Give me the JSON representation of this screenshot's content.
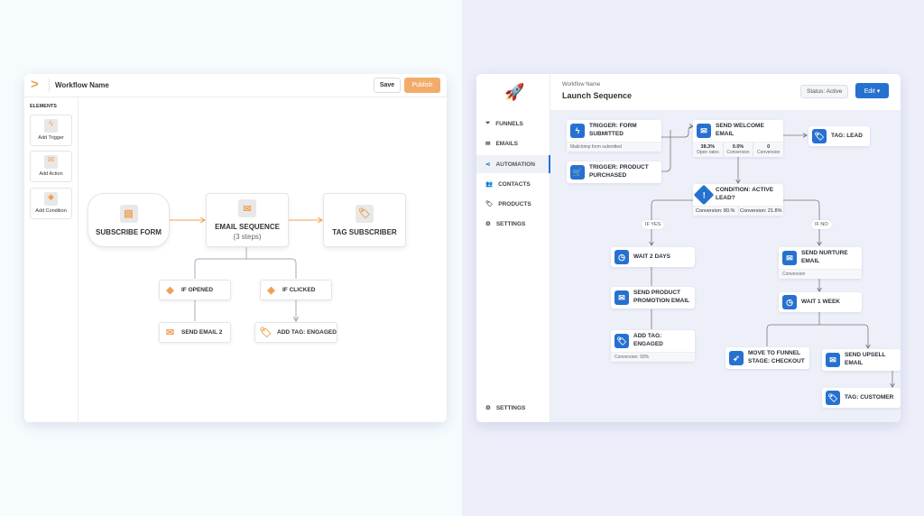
{
  "left": {
    "title": "Workflow Name",
    "save": "Save",
    "publish": "Publish",
    "elements_title": "ELEMENTS",
    "elements": [
      {
        "label": "Add Trigger",
        "icon": "bolt-icon"
      },
      {
        "label": "Add Action",
        "icon": "envelope-icon"
      },
      {
        "label": "Add Condition",
        "icon": "diamond-icon"
      }
    ],
    "nodes": {
      "subscribe": "SUBSCRIBE FORM",
      "email_seq": "EMAIL SEQUENCE",
      "email_steps": "(3 steps)",
      "tag_sub": "TAG SUBSCRIBER",
      "if_opened": "IF OPENED",
      "if_clicked": "IF CLICKED",
      "send_email2": "SEND EMAIL 2",
      "add_tag": "ADD TAG: ENGAGED"
    },
    "accent": "#f0a057"
  },
  "right": {
    "workflow_label": "Workflow Name",
    "title": "Launch Sequence",
    "status": "Status: Active",
    "edit": "Edit",
    "nav": [
      {
        "label": "FUNNELS",
        "icon": "funnel-icon"
      },
      {
        "label": "EMAILS",
        "icon": "envelope-icon"
      },
      {
        "label": "AUTOMATION",
        "icon": "share-icon",
        "active": true
      },
      {
        "label": "CONTACTS",
        "icon": "users-icon"
      },
      {
        "label": "PRODUCTS",
        "icon": "tag-icon"
      },
      {
        "label": "SETTINGS",
        "icon": "gear-icon"
      }
    ],
    "bottom_settings": "SETTINGS",
    "nodes": {
      "trigger_form": "TRIGGER: FORM SUBMITTED",
      "trigger_form_sub": "Mailchimp form submitted",
      "trigger_product": "TRIGGER: PRODUCT PURCHASED",
      "welcome": "SEND WELCOME EMAIL",
      "welcome_stats": [
        {
          "value": "38.3%",
          "label": "Open rates"
        },
        {
          "value": "0.0%",
          "label": "Conversion"
        },
        {
          "value": "0",
          "label": "Conversion"
        }
      ],
      "tag_lead": "TAG: LEAD",
      "condition": "CONDITION: ACTIVE LEAD?",
      "cond_a": "Conversion: 80.%",
      "cond_b": "Conversion: 21.8%",
      "if_yes": "IF YES",
      "if_no": "IF NO",
      "wait2": "WAIT 2 DAYS",
      "promo": "SEND PRODUCT PROMOTION EMAIL",
      "engaged": "ADD TAG: ENGAGED",
      "engaged_sub": "Conversion: 93%",
      "nurture": "SEND NURTURE EMAIL",
      "nurture_sub": "Conversion",
      "wait1": "WAIT 1 WEEK",
      "funnel": "MOVE TO FUNNEL STAGE: CHECKOUT",
      "upsell": "SEND UPSELL EMAIL",
      "customer": "TAG: CUSTOMER"
    },
    "accent": "#2671d0"
  }
}
